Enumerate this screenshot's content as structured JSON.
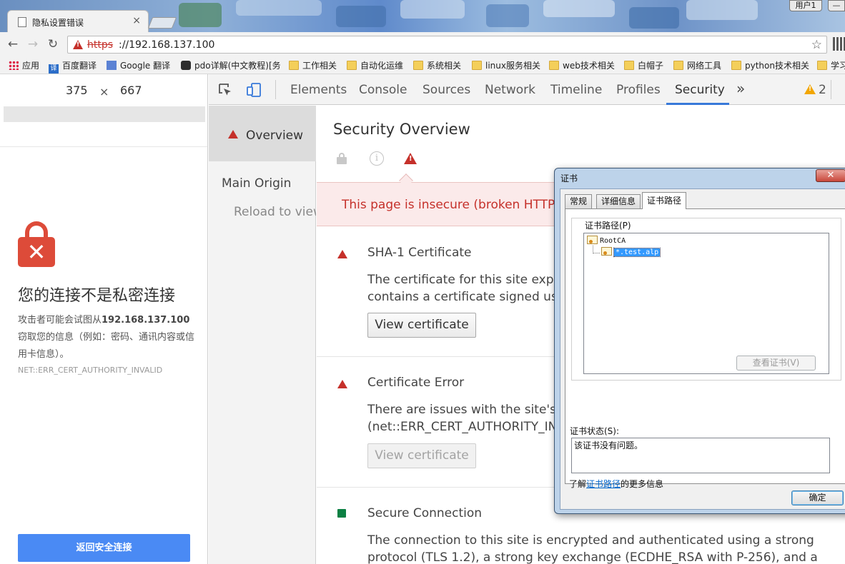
{
  "browser": {
    "tab_title": "隐私设置错误",
    "tab_close": "×",
    "user_button": "用户1",
    "url_scheme": "https",
    "url_rest": "://192.168.137.100",
    "bookmarks": [
      {
        "label": "应用",
        "icon": "apps-icon"
      },
      {
        "label": "百度翻译",
        "icon": "translate-icon"
      },
      {
        "label": "Google 翻译",
        "icon": "google-translate-icon"
      },
      {
        "label": "pdo详解(中文教程)[务",
        "icon": "paw-icon"
      },
      {
        "label": "工作相关",
        "icon": "folder-icon"
      },
      {
        "label": "自动化运维",
        "icon": "folder-icon"
      },
      {
        "label": "系统相关",
        "icon": "folder-icon"
      },
      {
        "label": "linux服务相关",
        "icon": "folder-icon"
      },
      {
        "label": "web技术相关",
        "icon": "folder-icon"
      },
      {
        "label": "白帽子",
        "icon": "folder-icon"
      },
      {
        "label": "网络工具",
        "icon": "folder-icon"
      },
      {
        "label": "python技术相关",
        "icon": "folder-icon"
      },
      {
        "label": "学习",
        "icon": "folder-icon"
      }
    ]
  },
  "device": {
    "width": "375",
    "times": "×",
    "height": "667",
    "interstitial": {
      "heading": "您的连接不是私密连接",
      "body_prefix": "攻击者可能会试图从",
      "body_host": "192.168.137.100",
      "body_suffix": "窃取您的信息（例如：密码、通讯内容或信用卡信息）。",
      "error_code": "NET::ERR_CERT_AUTHORITY_INVALID",
      "back_button": "返回安全连接"
    }
  },
  "devtools": {
    "tabs": [
      "Elements",
      "Console",
      "Sources",
      "Network",
      "Timeline",
      "Profiles",
      "Security"
    ],
    "active_tab": "Security",
    "more_tabs": "»",
    "warning_count": "2",
    "sidebar": {
      "overview": "Overview",
      "main_origin": "Main Origin",
      "reload": "Reload to view"
    },
    "security": {
      "title": "Security Overview",
      "summary": "This page is insecure (broken HTTPS).",
      "explanations": [
        {
          "title": "SHA-1 Certificate",
          "lines": [
            "The certificate for this site expires",
            "contains a certificate signed using"
          ],
          "button": "View certificate",
          "status": "insecure"
        },
        {
          "title": "Certificate Error",
          "lines": [
            "There are issues with the site's ce",
            "(net::ERR_CERT_AUTHORITY_INVA"
          ],
          "button": "View certificate",
          "status": "insecure"
        },
        {
          "title": "Secure Connection",
          "lines": [
            "The connection to this site is encrypted and authenticated using a strong",
            "protocol (TLS 1.2), a strong key exchange (ECDHE_RSA with P-256), and a"
          ],
          "status": "secure"
        }
      ]
    }
  },
  "cert_dialog": {
    "title": "证书",
    "close": "✕",
    "tabs": [
      "常规",
      "详细信息",
      "证书路径"
    ],
    "active_tab": "证书路径",
    "path_label": "证书路径(P)",
    "tree": [
      "RootCA",
      "*.test.alp"
    ],
    "view_button": "查看证书(V)",
    "status_label": "证书状态(S):",
    "status_text": "该证书没有问题。",
    "learn_prefix": "了解",
    "learn_link": "证书路径",
    "learn_suffix": "的更多信息",
    "ok_button": "确定"
  },
  "colors": {
    "insecure_red": "#c5302a",
    "secure_green": "#0b8043",
    "devtools_accent": "#3879d9",
    "interstitial_button": "#4a8af4"
  }
}
